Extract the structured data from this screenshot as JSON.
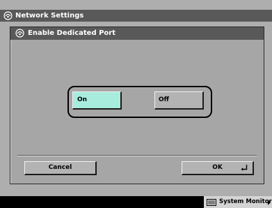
{
  "titlebar": {
    "title": "Network Settings",
    "icon": "network-settings-icon"
  },
  "dialog": {
    "title": "Enable Dedicated Port",
    "icon": "network-settings-icon",
    "options": {
      "on_label": "On",
      "off_label": "Off",
      "selected": "On"
    },
    "cancel_label": "Cancel",
    "ok_label": "OK"
  },
  "footer": {
    "system_monitor_label": "System Monitor"
  },
  "colors": {
    "selected_button": "#a8ecdd",
    "title_bar": "#595959",
    "background": "#aeaeae"
  }
}
